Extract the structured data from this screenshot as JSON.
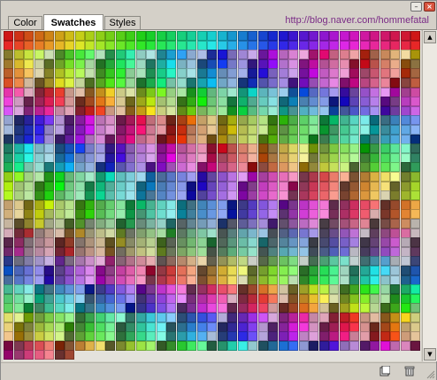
{
  "window": {
    "minimize_glyph": "–",
    "close_glyph": "×"
  },
  "tabs": [
    {
      "label": "Color",
      "active": false
    },
    {
      "label": "Swatches",
      "active": true
    },
    {
      "label": "Styles",
      "active": false
    }
  ],
  "blog_url": "http://blog.naver.com/hommefatal",
  "swatches": {
    "row_hues": [
      0,
      28,
      18,
      40,
      5,
      340,
      320,
      290,
      255,
      225,
      200,
      185,
      165,
      140,
      110,
      80,
      60,
      45,
      35,
      20,
      0,
      340,
      300,
      270,
      230,
      200,
      180,
      160,
      120,
      90,
      60,
      30,
      0,
      330,
      300
    ],
    "scrollbar": {
      "up_icon": "arrow-up-icon",
      "down_icon": "arrow-down-icon"
    }
  },
  "bottom_icons": {
    "new_swatch": "new-swatch-icon",
    "delete": "trash-icon",
    "grip": "resize-grip-icon"
  },
  "colors": {
    "tab_active_bg": "#ffffff",
    "panel_bg": "#d4d0c8",
    "url_color": "#7a2b86",
    "close_red": "#d9543f"
  }
}
